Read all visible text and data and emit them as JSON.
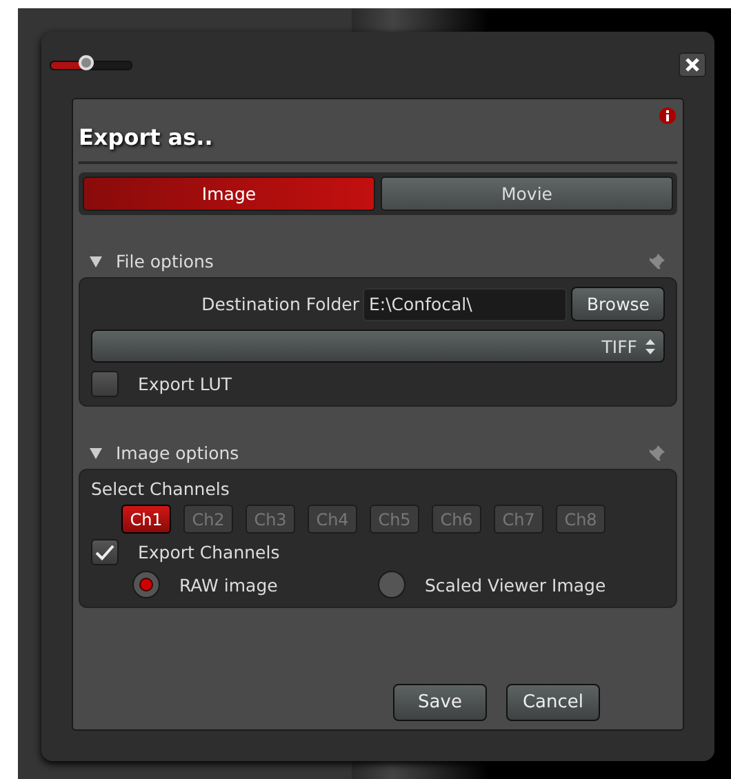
{
  "zoom_slider": {
    "level": 0.45
  },
  "dialog": {
    "title": "Export as..",
    "tabs": [
      {
        "label": "Image",
        "selected": true
      },
      {
        "label": "Movie",
        "selected": false
      }
    ],
    "file_options": {
      "title": "File options",
      "expanded": true,
      "destination_label": "Destination Folder",
      "destination_value": "E:\\Confocal\\",
      "browse_button": "Browse",
      "format": "TIFF",
      "export_lut": {
        "label": "Export LUT",
        "checked": false
      }
    },
    "image_options": {
      "title": "Image options",
      "expanded": true,
      "select_channels_label": "Select Channels",
      "channels": [
        {
          "label": "Ch1",
          "selected": true
        },
        {
          "label": "Ch2",
          "selected": false
        },
        {
          "label": "Ch3",
          "selected": false
        },
        {
          "label": "Ch4",
          "selected": false
        },
        {
          "label": "Ch5",
          "selected": false
        },
        {
          "label": "Ch6",
          "selected": false
        },
        {
          "label": "Ch7",
          "selected": false
        },
        {
          "label": "Ch8",
          "selected": false
        }
      ],
      "export_channels": {
        "label": "Export Channels",
        "checked": true
      },
      "image_type": [
        {
          "label": "RAW image",
          "selected": true
        },
        {
          "label": "Scaled Viewer Image",
          "selected": false
        }
      ]
    },
    "buttons": [
      "Save",
      "Cancel"
    ]
  }
}
